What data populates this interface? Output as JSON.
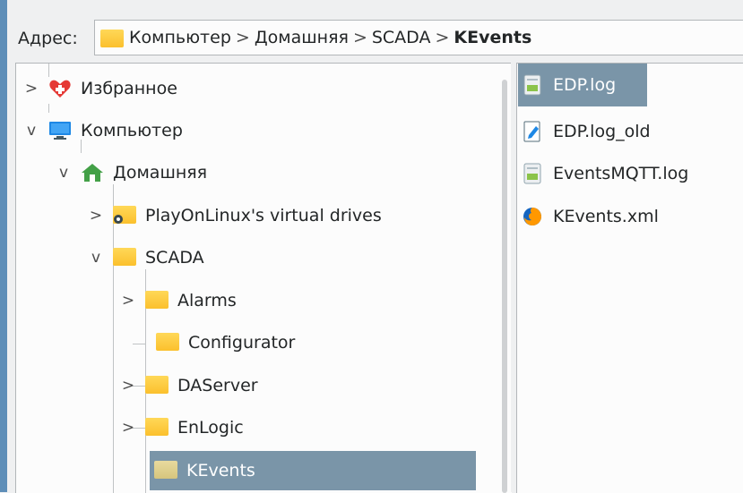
{
  "address": {
    "label": "Адрес:",
    "crumbs": [
      "Компьютер",
      "Домашняя",
      "SCADA"
    ],
    "separator": ">",
    "current": "KEvents"
  },
  "tree": {
    "items": [
      {
        "label": "Избранное",
        "icon": "favorites-heart-icon",
        "expanded": false
      },
      {
        "label": "Компьютер",
        "icon": "computer-icon",
        "expanded": true
      },
      {
        "label": "Домашняя",
        "icon": "home-icon",
        "expanded": true
      },
      {
        "label": "PlayOnLinux's virtual drives",
        "icon": "folder-icon",
        "expanded": false
      },
      {
        "label": "SCADA",
        "icon": "folder-icon",
        "expanded": true
      },
      {
        "label": "Alarms",
        "icon": "folder-icon",
        "expanded": false
      },
      {
        "label": "Configurator",
        "icon": "folder-icon"
      },
      {
        "label": "DAServer",
        "icon": "folder-icon",
        "expanded": false
      },
      {
        "label": "EnLogic",
        "icon": "folder-icon",
        "expanded": false
      },
      {
        "label": "KEvents",
        "icon": "folder-icon",
        "selected": true
      }
    ],
    "arrow_collapsed": ">",
    "arrow_expanded": "v"
  },
  "files": {
    "items": [
      {
        "label": "EDP.log",
        "icon": "log-file-icon",
        "selected": true
      },
      {
        "label": "EDP.log_old",
        "icon": "text-file-icon"
      },
      {
        "label": "EventsMQTT.log",
        "icon": "log-file-icon"
      },
      {
        "label": "KEvents.xml",
        "icon": "firefox-icon"
      }
    ]
  },
  "colors": {
    "selection": "#7a95a8",
    "folder": "#fbc02d",
    "accent": "#5e8eb8"
  }
}
